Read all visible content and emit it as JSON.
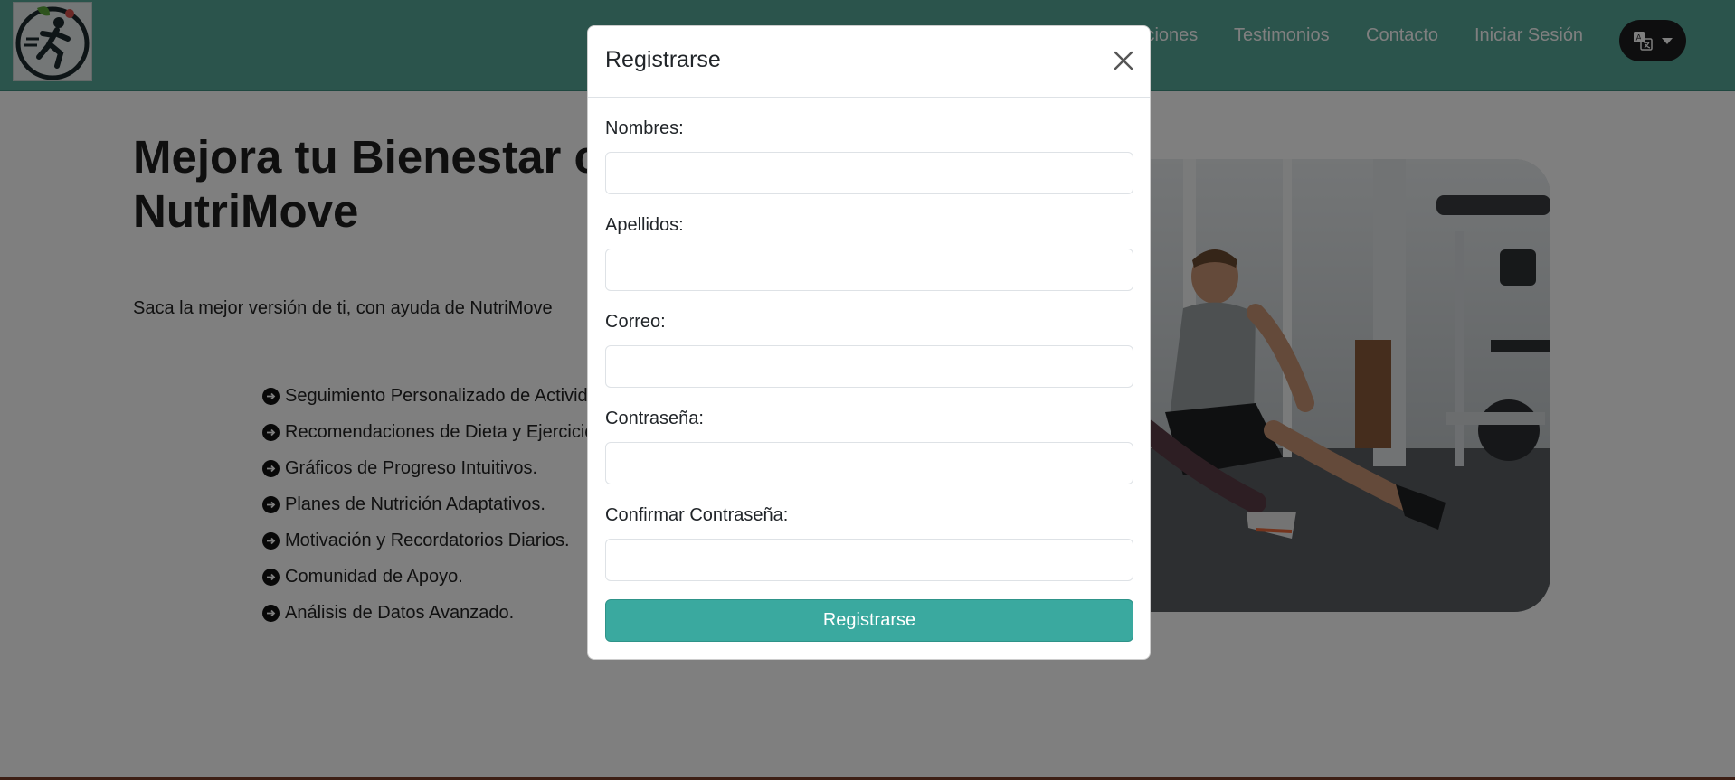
{
  "nav": {
    "links": [
      "Funciones",
      "Testimonios",
      "Contacto",
      "Iniciar Sesión"
    ],
    "language_button_icon": "translate-icon",
    "colors": {
      "navbar": "#56a899",
      "language_button": "#1d1d1f"
    }
  },
  "hero": {
    "title_line1": "Mejora tu Bienestar con",
    "title_line2": "NutriMove",
    "subtitle": "Saca la mejor versión de ti, con ayuda de NutriMove",
    "features": [
      "Seguimiento Personalizado de Actividad.",
      "Recomendaciones de Dieta y Ejercicio.",
      "Gráficos de Progreso Intuitivos.",
      "Planes de Nutrición Adaptativos.",
      "Motivación y Recordatorios Diarios.",
      "Comunidad de Apoyo.",
      "Análisis de Datos Avanzado."
    ]
  },
  "modal": {
    "title": "Registrarse",
    "fields": {
      "nombres": {
        "label": "Nombres:",
        "value": ""
      },
      "apellidos": {
        "label": "Apellidos:",
        "value": ""
      },
      "correo": {
        "label": "Correo:",
        "value": ""
      },
      "contrasena": {
        "label": "Contraseña:",
        "value": ""
      },
      "confirmar": {
        "label": "Confirmar Contraseña:",
        "value": ""
      }
    },
    "submit_label": "Registrarse",
    "colors": {
      "submit": "#3aa99f"
    }
  }
}
